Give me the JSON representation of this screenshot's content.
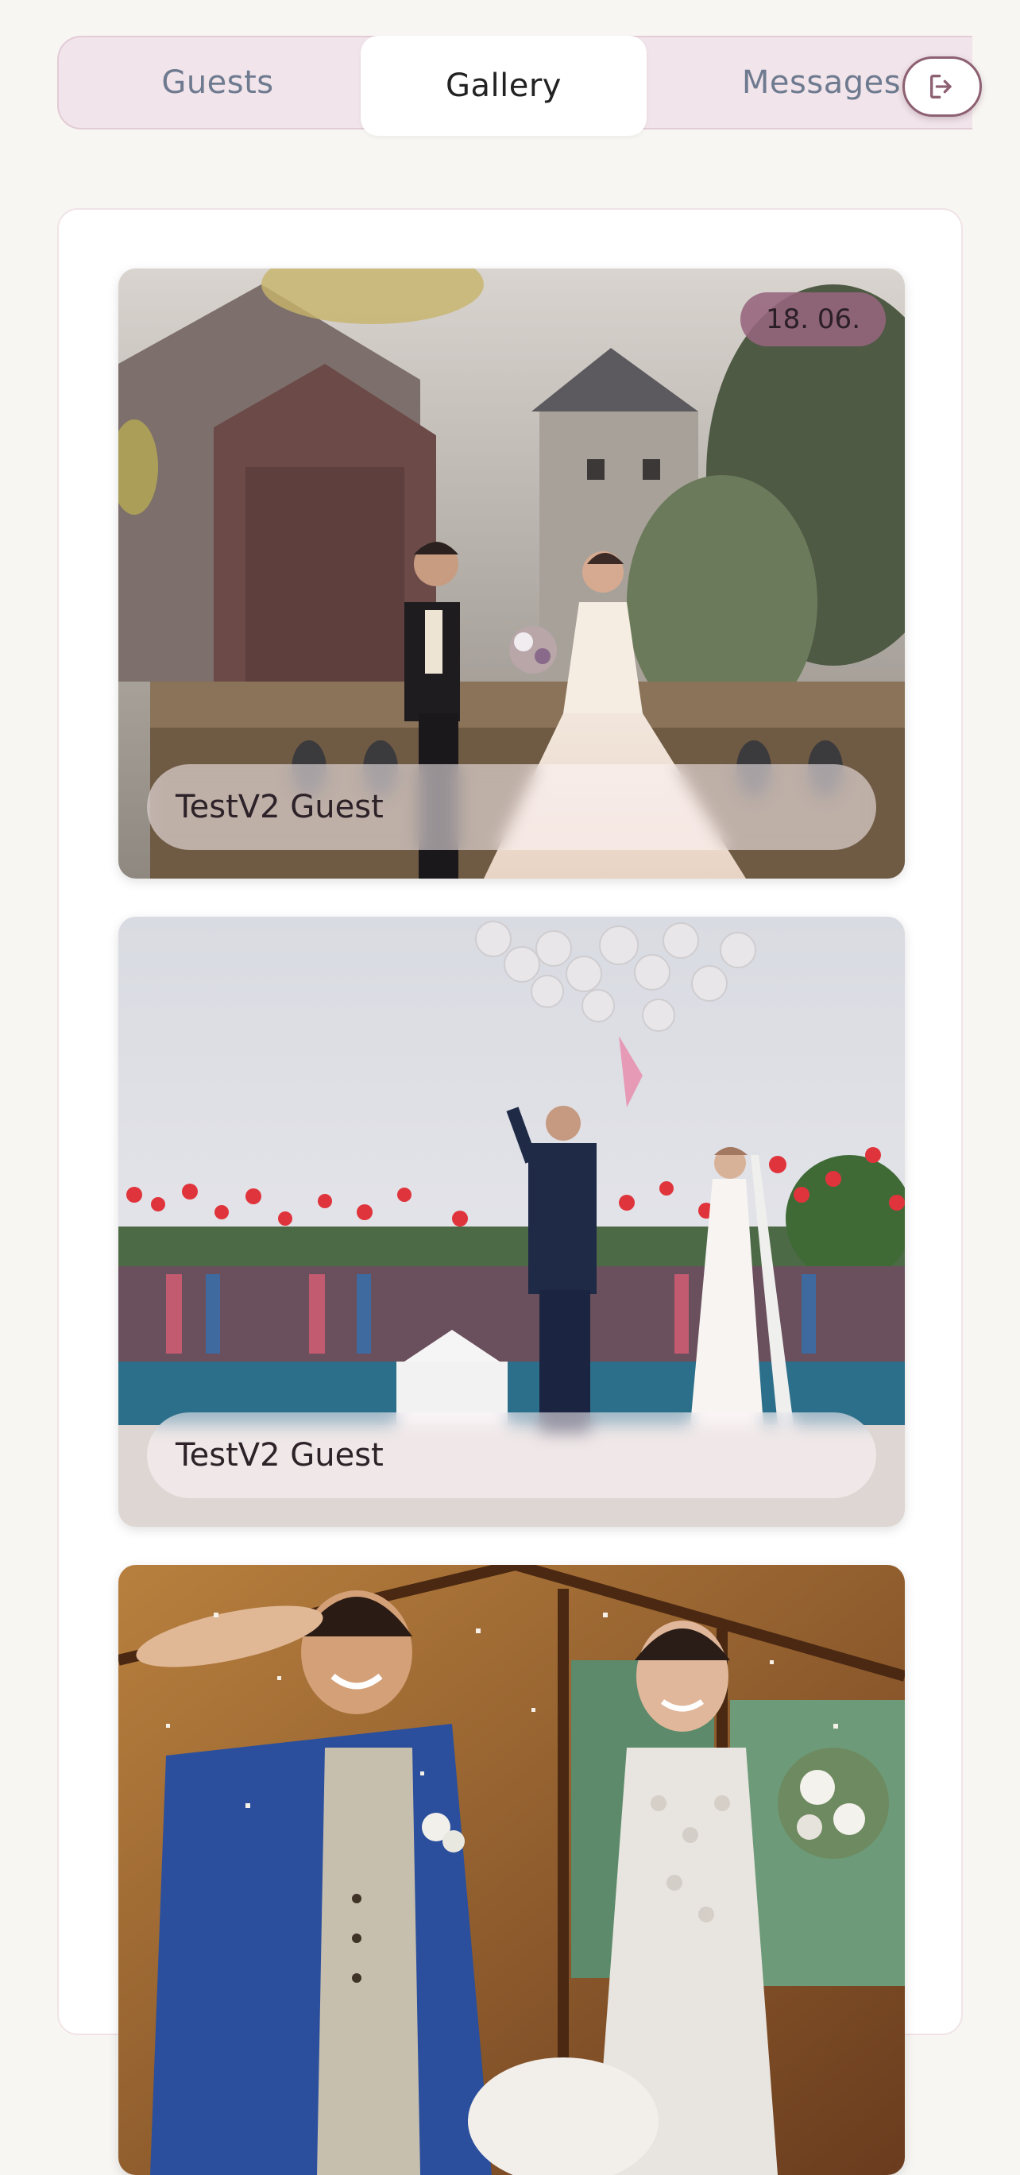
{
  "tabs": {
    "guests": "Guests",
    "gallery": "Gallery",
    "messages": "Messages",
    "active": "gallery"
  },
  "header": {
    "logout_icon": "logout-icon"
  },
  "gallery": {
    "items": [
      {
        "date": "18. 06.",
        "guest": "TestV2 Guest",
        "photo": "castle-couple-photo"
      },
      {
        "guest": "TestV2 Guest",
        "photo": "balloon-pool-couple-photo"
      },
      {
        "photo": "confetti-couple-photo"
      }
    ]
  },
  "colors": {
    "accent": "#8d6072",
    "tab_bg": "#f1e4ea",
    "page_bg": "#f8f6f3"
  }
}
